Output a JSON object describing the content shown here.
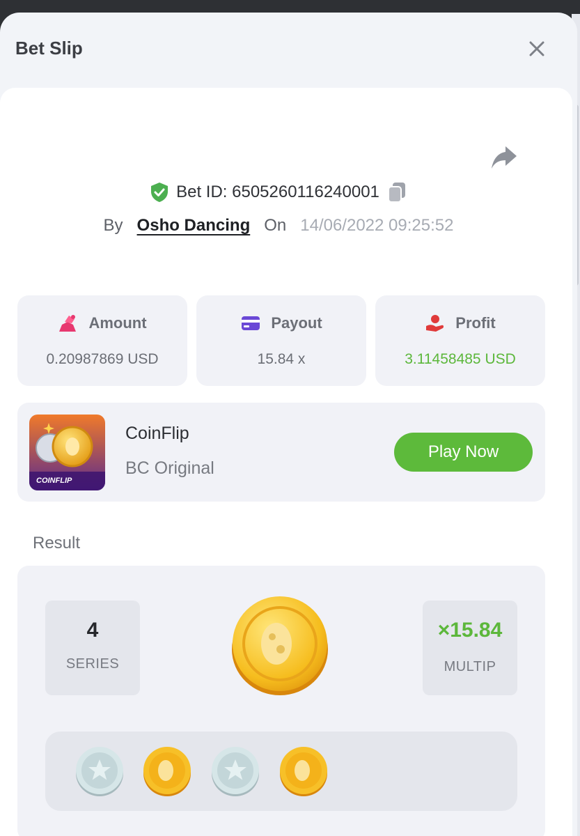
{
  "modal": {
    "title": "Bet Slip"
  },
  "bet": {
    "id_label": "Bet ID: 6505260116240001",
    "by_label": "By",
    "user": "Osho Dancing",
    "on_label": "On",
    "datetime": "14/06/2022 09:25:52"
  },
  "stats": [
    {
      "label": "Amount",
      "value": "0.20987869 USD",
      "icon": "amount-icon"
    },
    {
      "label": "Payout",
      "value": "15.84 x",
      "icon": "card-icon"
    },
    {
      "label": "Profit",
      "value": "3.11458485 USD",
      "icon": "profit-hand-icon"
    }
  ],
  "game": {
    "name": "CoinFlip",
    "provider": "BC Original",
    "thumb_text": "COINFLIP",
    "play_label": "Play Now"
  },
  "result": {
    "label": "Result",
    "series_value": "4",
    "series_label": "SERIES",
    "multiplier": "×15.84",
    "multiplier_label": "MULTIP",
    "coins": [
      "silver-star",
      "gold",
      "silver-star",
      "gold"
    ]
  },
  "colors": {
    "accent_green": "#5dba3b",
    "profit_green": "#5cb73b",
    "card_bg": "#f1f2f7"
  }
}
